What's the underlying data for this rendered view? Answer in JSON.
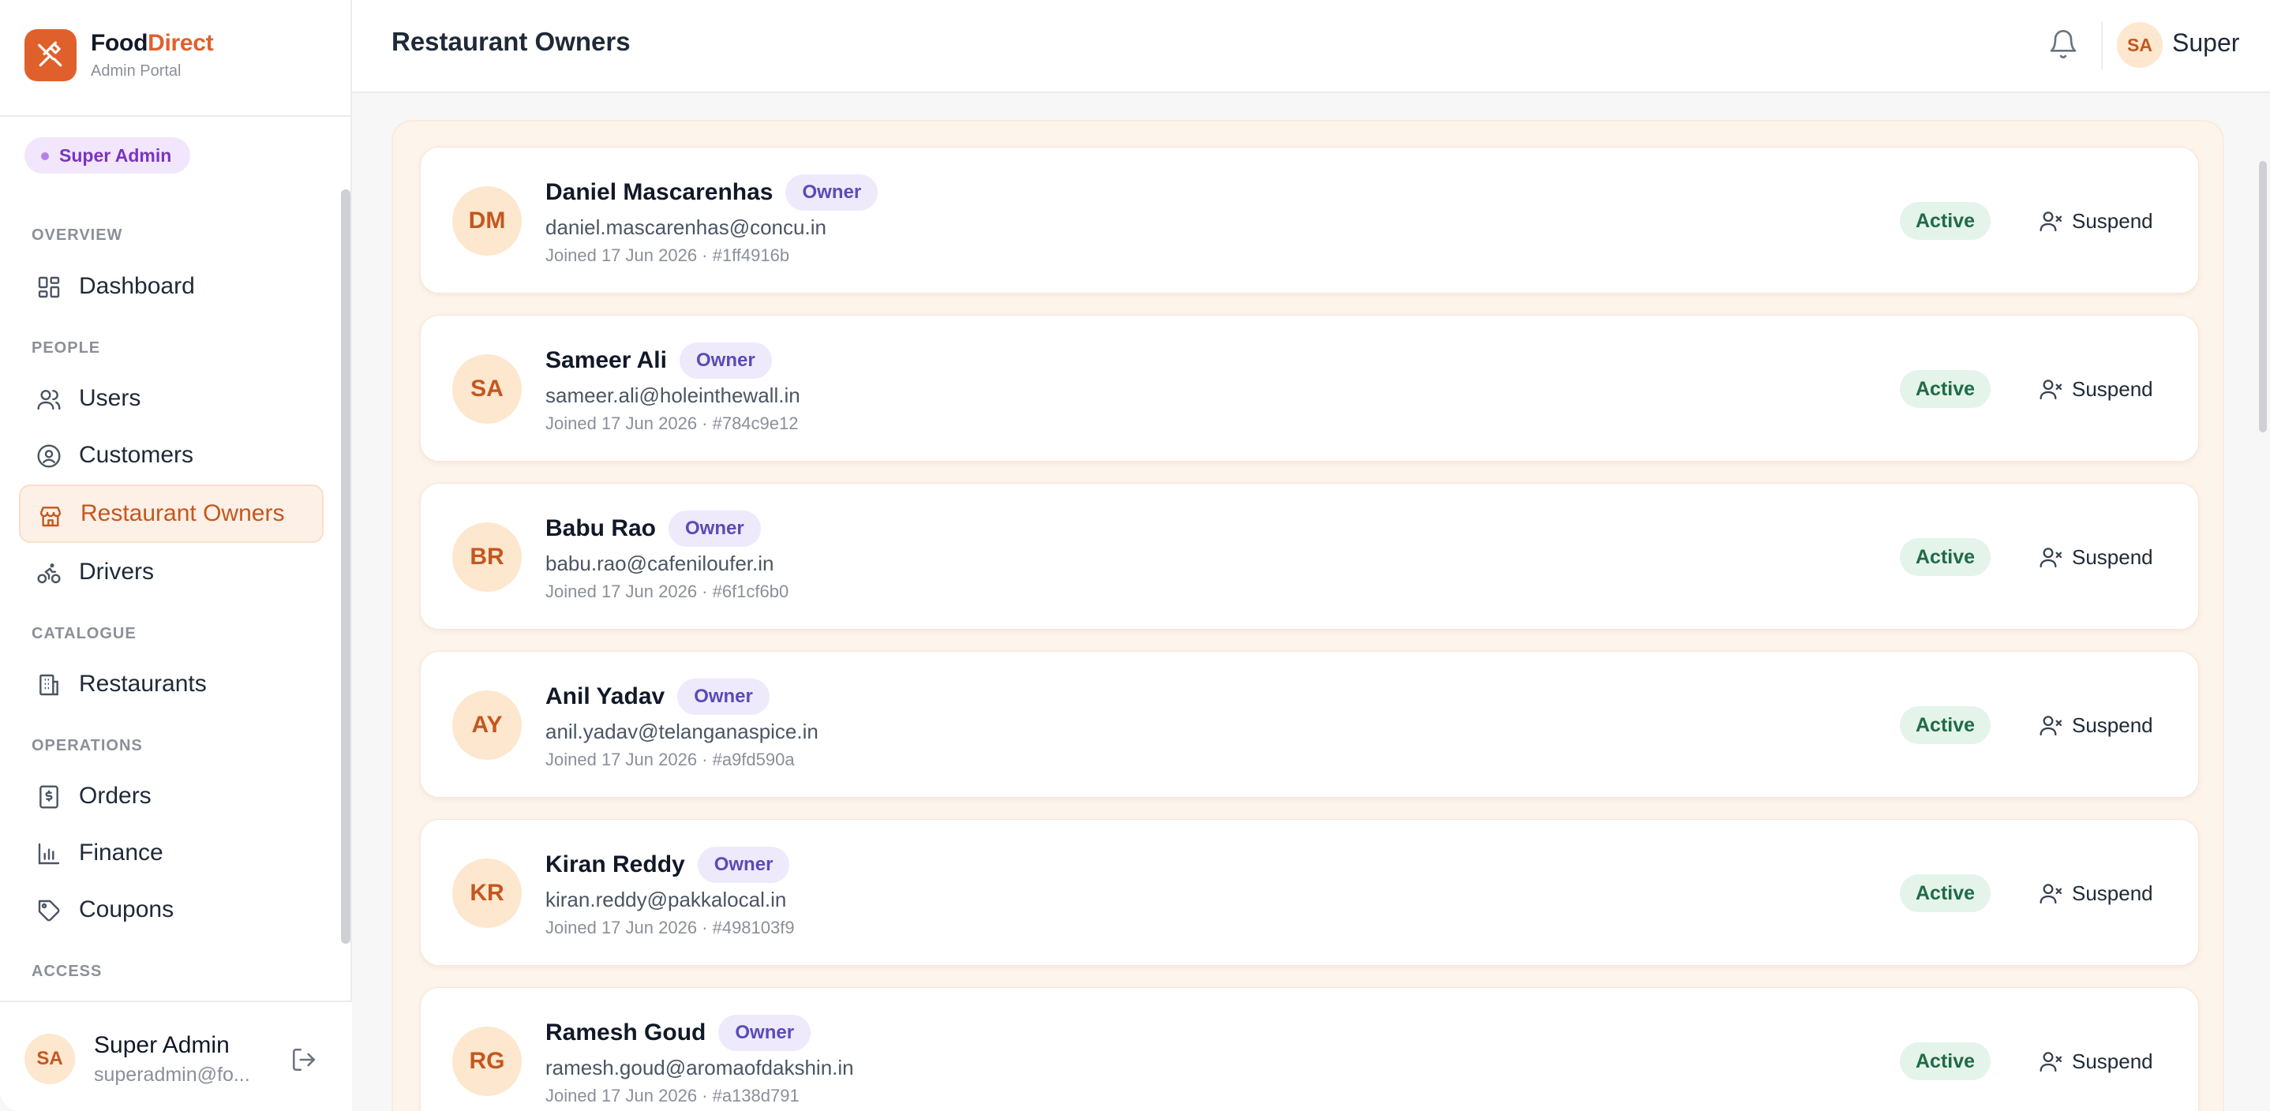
{
  "brand": {
    "name_part1": "Food",
    "name_part2": "Direct",
    "subtitle": "Admin Portal"
  },
  "role_badge": "Super Admin",
  "nav": {
    "sections": [
      {
        "label": "OVERVIEW",
        "items": [
          {
            "label": "Dashboard",
            "icon": "dashboard-icon"
          }
        ]
      },
      {
        "label": "PEOPLE",
        "items": [
          {
            "label": "Users",
            "icon": "users-icon"
          },
          {
            "label": "Customers",
            "icon": "customer-icon"
          },
          {
            "label": "Restaurant Owners",
            "icon": "store-icon",
            "active": true
          },
          {
            "label": "Drivers",
            "icon": "bike-icon"
          }
        ]
      },
      {
        "label": "CATALOGUE",
        "items": [
          {
            "label": "Restaurants",
            "icon": "building-icon"
          }
        ]
      },
      {
        "label": "OPERATIONS",
        "items": [
          {
            "label": "Orders",
            "icon": "receipt-icon"
          },
          {
            "label": "Finance",
            "icon": "bar-chart-icon"
          },
          {
            "label": "Coupons",
            "icon": "tag-icon"
          }
        ]
      },
      {
        "label": "ACCESS",
        "items": []
      }
    ]
  },
  "footer_user": {
    "initials": "SA",
    "name": "Super Admin",
    "email": "superadmin@fo..."
  },
  "header": {
    "title": "Restaurant Owners",
    "user_initials": "SA",
    "user_name": "Super"
  },
  "owners": [
    {
      "initials": "DM",
      "name": "Daniel Mascarenhas",
      "role": "Owner",
      "email": "daniel.mascarenhas@concu.in",
      "meta": "Joined 17 Jun 2026 · #1ff4916b",
      "status": "Active",
      "action": "Suspend"
    },
    {
      "initials": "SA",
      "name": "Sameer Ali",
      "role": "Owner",
      "email": "sameer.ali@holeinthewall.in",
      "meta": "Joined 17 Jun 2026 · #784c9e12",
      "status": "Active",
      "action": "Suspend"
    },
    {
      "initials": "BR",
      "name": "Babu Rao",
      "role": "Owner",
      "email": "babu.rao@cafeniloufer.in",
      "meta": "Joined 17 Jun 2026 · #6f1cf6b0",
      "status": "Active",
      "action": "Suspend"
    },
    {
      "initials": "AY",
      "name": "Anil Yadav",
      "role": "Owner",
      "email": "anil.yadav@telanganaspice.in",
      "meta": "Joined 17 Jun 2026 · #a9fd590a",
      "status": "Active",
      "action": "Suspend"
    },
    {
      "initials": "KR",
      "name": "Kiran Reddy",
      "role": "Owner",
      "email": "kiran.reddy@pakkalocal.in",
      "meta": "Joined 17 Jun 2026 · #498103f9",
      "status": "Active",
      "action": "Suspend"
    },
    {
      "initials": "RG",
      "name": "Ramesh Goud",
      "role": "Owner",
      "email": "ramesh.goud@aromaofdakshin.in",
      "meta": "Joined 17 Jun 2026 · #a138d791",
      "status": "Active",
      "action": "Suspend"
    }
  ],
  "colors": {
    "accent": "#e0602c",
    "active_bg": "#fdf0e6",
    "status_green": "#1f6b45",
    "role_purple": "#5b4bb6"
  }
}
